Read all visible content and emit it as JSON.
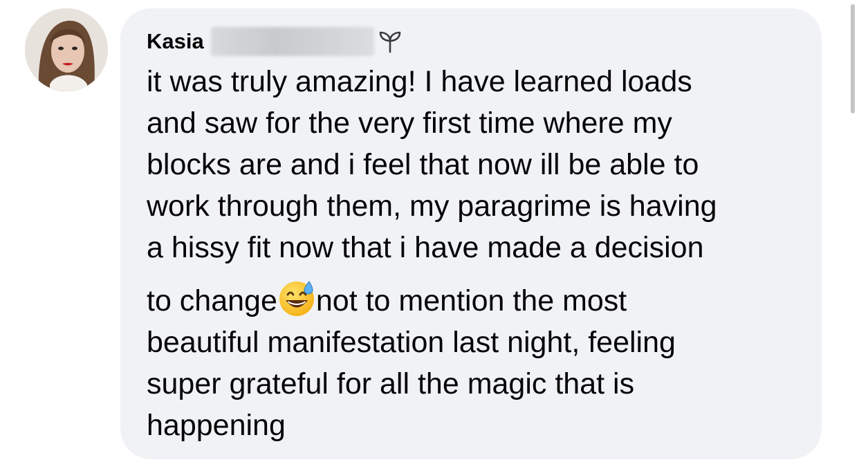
{
  "comment": {
    "author_first_name": "Kasia",
    "author_badge_icon": "sprout-icon",
    "body_lines": [
      "it was truly amazing! I have learned loads",
      "and saw for the very first time where my",
      "blocks are and i feel that now ill be able to",
      "work through them, my paragrime is having",
      "a hissy fit now that i have made a decision",
      "to change",
      "not to mention the most",
      "beautiful manifestation last night, feeling",
      "super grateful for all the magic that is",
      "happening"
    ],
    "emoji": "grinning-face-with-sweat-emoji"
  },
  "colors": {
    "bubble_background": "#f0f2f5",
    "text": "#050505",
    "page_background": "#ffffff"
  }
}
